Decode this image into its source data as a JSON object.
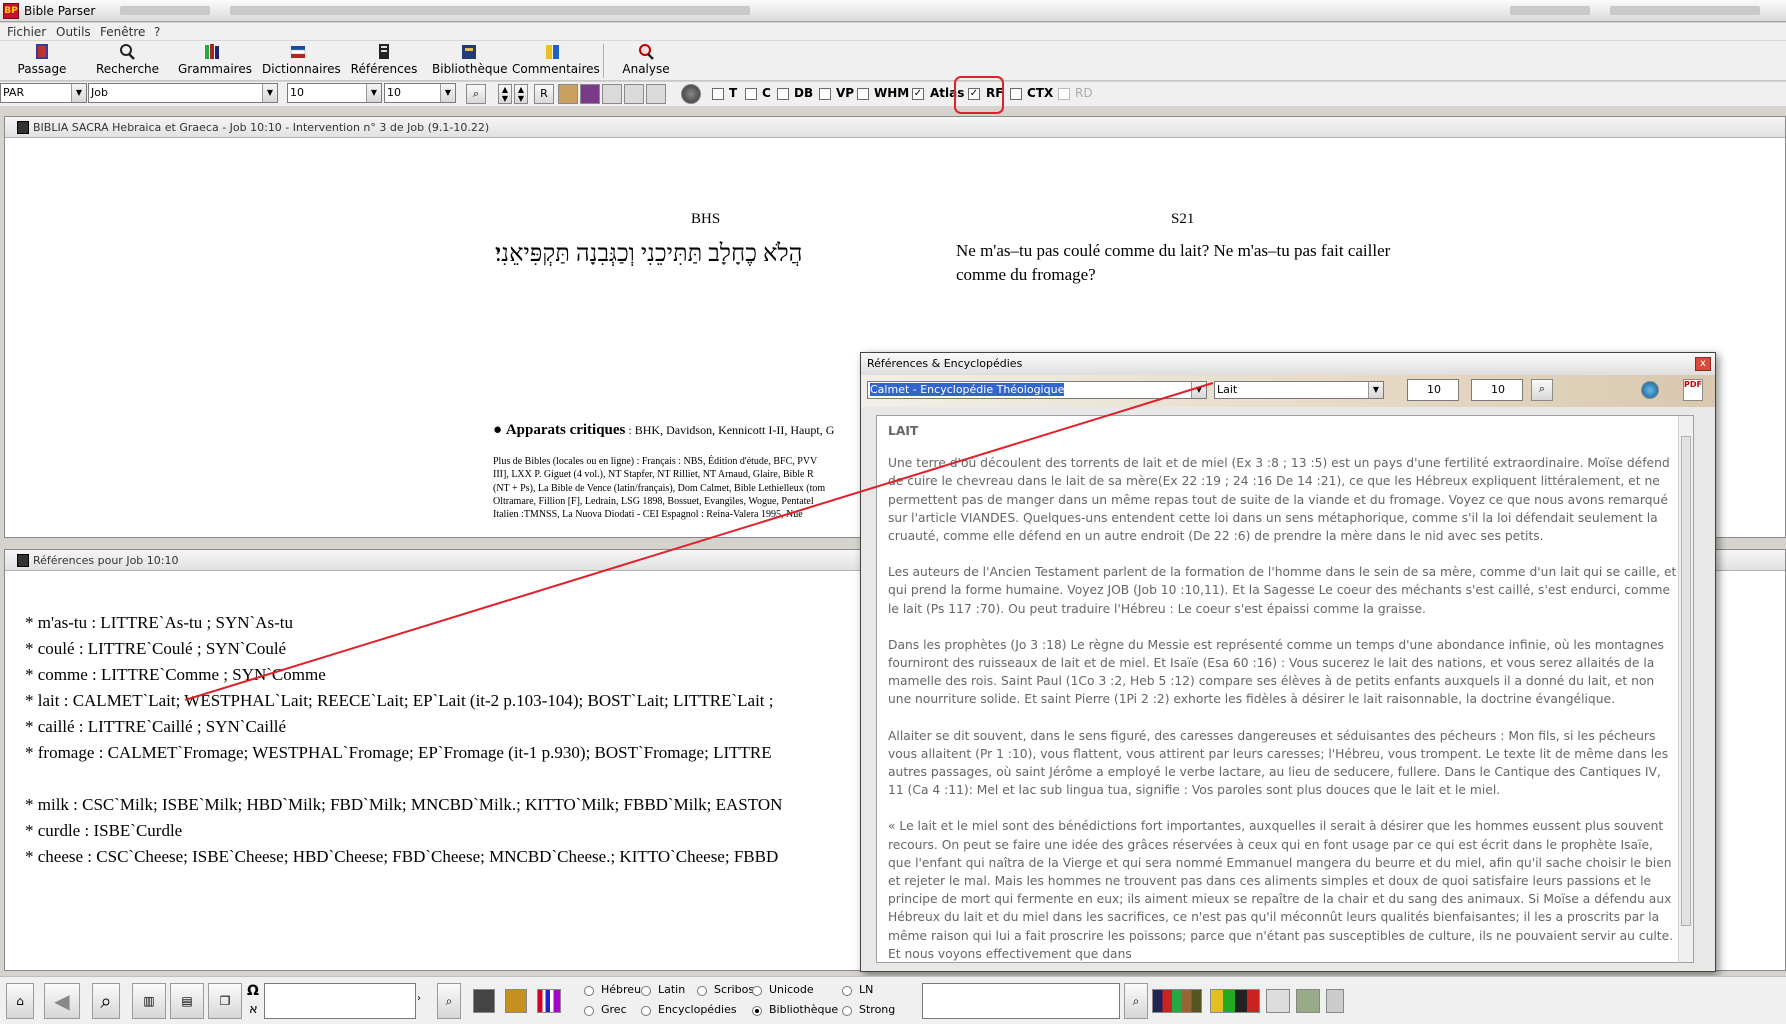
{
  "window": {
    "title": "Bible Parser"
  },
  "menu": {
    "items": [
      "Fichier",
      "Outils",
      "Fenêtre",
      "?"
    ]
  },
  "toolbar": {
    "buttons": [
      "Passage",
      "Recherche",
      "Grammaires",
      "Dictionnaires",
      "Références",
      "Bibliothèque",
      "Commentaires",
      "Analyse"
    ]
  },
  "selectors": {
    "version": "PAR",
    "book": "Job",
    "chapter": "10",
    "verse": "10"
  },
  "small_buttons": {
    "r_label": "R"
  },
  "checkboxes": [
    {
      "label": "T",
      "checked": false
    },
    {
      "label": "C",
      "checked": false
    },
    {
      "label": "DB",
      "checked": false
    },
    {
      "label": "VP",
      "checked": false
    },
    {
      "label": "WHM",
      "checked": false
    },
    {
      "label": "Atlas",
      "checked": true
    },
    {
      "label": "RF",
      "checked": true
    },
    {
      "label": "CTX",
      "checked": false
    },
    {
      "label": "RD",
      "checked": false,
      "disabled": true
    }
  ],
  "bible_pane": {
    "title": "BIBLIA SACRA Hebraica et Graeca - Job 10:10 - Intervention n° 3 de Job (9.1-10.22)",
    "left_header": "BHS",
    "hebrew_text": "הֲלֹא כֶחָלָב תַּתִּיכֵנִי וְכַגְּבִנָה תַּקְפִּיאֵנִי׃",
    "right_header": "S21",
    "french_text": "Ne m'as–tu pas coulé comme du lait? Ne m'as–tu pas fait cailler comme du fromage?",
    "apparats_title": "Apparats critiques",
    "apparats_sources": " : BHK, Davidson, Kennicott I-II, Haupt, G",
    "more_bibles_lines": [
      "Plus de Bibles (locales ou en ligne) : Français : NBS, Édition d'étude, BFC, PVV",
      "III], LXX P. Giguet (4 vol.), NT Stapfer, NT Rilliet, NT Arnaud, Glaire, Bible R",
      "(NT + Ps), La Bible de Vence (latin/français), Dom Calmet, Bible Lethielleux (tom",
      "Oltramare, Fillion [F], Ledrain, LSG 1898, Bossuet, Evangiles, Wogue, Pentatel",
      "Italien :TMNSS, La Nuova Diodati - CEI Espagnol : Reina-Valera 1995, Nue"
    ]
  },
  "refs_pane": {
    "title": "Références pour Job 10:10",
    "lines": [
      "* m'as-tu : LITTRE`As-tu ; SYN`As-tu",
      "* coulé : LITTRE`Coulé ; SYN`Coulé",
      "* comme : LITTRE`Comme ; SYN`Comme",
      "* lait : CALMET`Lait; WESTPHAL`Lait; REECE`Lait; EP`Lait (it-2 p.103-104); BOST`Lait; LITTRE`Lait ;",
      "* caillé : LITTRE`Caillé ; SYN`Caillé",
      "* fromage : CALMET`Fromage; WESTPHAL`Fromage; EP`Fromage (it-1 p.930); BOST`Fromage; LITTRE",
      "",
      "*  milk  : CSC`Milk; ISBE`Milk; HBD`Milk; FBD`Milk; MNCBD`Milk.; KITTO`Milk; FBBD`Milk; EASTON",
      "*  curdle  : ISBE`Curdle",
      "*  cheese  : CSC`Cheese; ISBE`Cheese; HBD`Cheese; FBD`Cheese; MNCBD`Cheese.; KITTO`Cheese; FBBD"
    ]
  },
  "popup": {
    "title": "Références & Encyclopédies",
    "source": "Calmet - Encyclopédie Théologique",
    "entry": "Lait",
    "num1": "10",
    "num2": "10",
    "close_label": "x",
    "heading": "LAIT",
    "paragraphs": [
      "Une terre d'où découlent des torrents de lait et de miel (Ex 3 :8 ; 13 :5) est un pays d'une fertilité extraordinaire. Moïse défend de cuire le chevreau dans le lait de sa mère(Ex 22 :19 ; 24 :16 De 14 :21), ce que les Hébreux expliquent littéralement, et ne permettent pas de manger dans un même repas tout de suite de la viande et du fromage. Voyez ce que nous avons remarqué sur l'article VIANDES. Quelques-uns entendent cette loi dans un sens métaphorique, comme s'il la loi défendait seulement la cruauté, comme elle défend en un autre endroit (De 22 :6) de prendre la mère dans le nid avec ses petits.",
      "Les auteurs de l'Ancien Testament parlent de la formation de l'homme dans le sein de sa mère, comme d'un lait qui se caille, et qui prend la forme humaine. Voyez JOB (Job 10 :10,11). Et la Sagesse Le coeur des méchants s'est caillé, s'est endurci, comme le lait (Ps 117 :70). Ou peut traduire l'Hébreu : Le coeur s'est épaissi comme la graisse.",
      "Dans les prophètes (Jo 3 :18) Le règne du Messie est représenté comme un temps d'une abondance infinie, où les montagnes fourniront des ruisseaux de lait et de miel. Et Isaïe (Esa 60 :16) : Vous sucerez le lait des nations, et vous serez allaités de la mamelle des rois. Saint Paul (1Co 3 :2, Heb 5 :12) compare ses élèves à de petits enfants auxquels il a donné du lait, et non une nourriture solide. Et saint Pierre (1Pi 2 :2) exhorte les fidèles à désirer le lait raisonnable, la doctrine évangélique.",
      "Allaiter se dit souvent, dans le sens figuré, des caresses dangereuses et séduisantes des pécheurs : Mon fils, si les pécheurs vous allaitent (Pr 1 :10), vous flattent, vous attirent par leurs caresses; l'Hébreu, vous trompent. Le texte lit de même dans les autres passages, où saint Jérôme a employé le verbe lactare, au lieu de seducere, fullere. Dans le Cantique des Cantiques IV, 11 (Ca 4 :11): Mel et lac sub lingua tua, signifie : Vos paroles sont plus douces que le lait et le miel.",
      "« Le lait et le miel sont des bénédictions fort importantes, auxquelles il serait à désirer que les hommes eussent plus souvent recours. On peut se faire une idée des grâces réservées à ceux qui en font usage par ce qui est écrit dans le prophète Isaïe, que l'enfant qui naîtra de la Vierge et qui sera nommé Emmanuel mangera du beurre et du miel, afin qu'il sache choisir le bien et rejeter le mal. Mais les hommes ne trouvent pas dans ces aliments simples et doux de quoi satisfaire leurs passions et le principe de mort qui fermente en eux; ils aiment mieux se repaître de la chair et du sang des animaux. Si Moïse a défendu aux Hébreux du lait et du miel dans les sacrifices, ce n'est pas qu'il méconnût leurs qualités bienfaisantes; il les a proscrits par la même raison qui lui a fait proscrire les poissons; parce que n'étant pas susceptibles de culture, ils ne pouvaient servir au culte. Et nous voyons effectivement que dans"
    ]
  },
  "bottom": {
    "omega_label": "Ω",
    "aleph_label": "א",
    "radios": [
      {
        "label": "Hébreu",
        "checked": false
      },
      {
        "label": "Latin",
        "checked": false
      },
      {
        "label": "Scribos",
        "checked": false
      },
      {
        "label": "Unicode",
        "checked": false
      },
      {
        "label": "LN",
        "checked": false
      },
      {
        "label": "Grec",
        "checked": false
      },
      {
        "label": "Encyclopédies",
        "checked": false
      },
      {
        "label": "Bibliothèque",
        "checked": true
      },
      {
        "label": "Strong",
        "checked": false
      }
    ]
  },
  "colors": {
    "annotation": "#e0202a",
    "accent_blue": "#3366cc"
  }
}
